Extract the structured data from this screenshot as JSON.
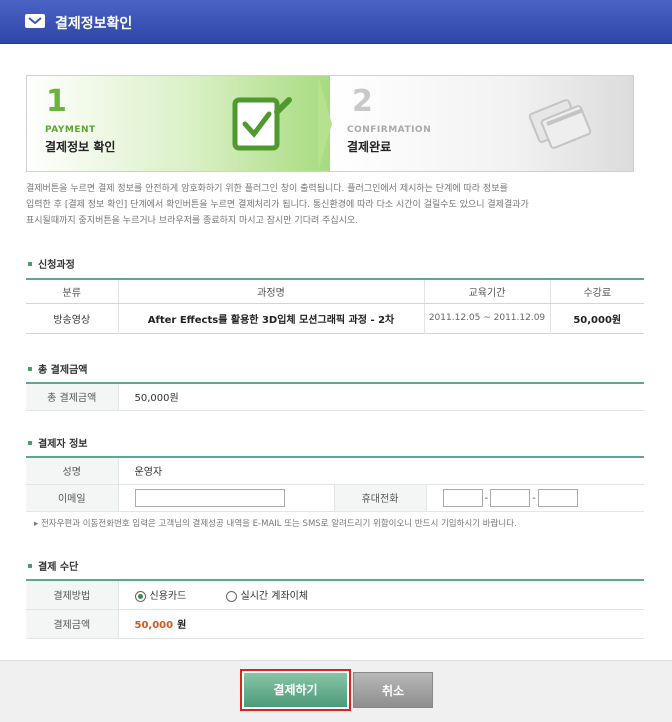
{
  "header": {
    "title": "결제정보확인"
  },
  "steps": [
    {
      "number": "1",
      "en": "PAYMENT",
      "ko": "결제정보 확인"
    },
    {
      "number": "2",
      "en": "CONFIRMATION",
      "ko": "결제완료"
    }
  ],
  "description": [
    "결제버튼을 누르면 결제 정보를 안전하게 암호화하기 위한 플러그인 창이 출력됩니다. 플러그인에서 제시하는 단계에 따라 정보를",
    "입력한 후 [결제 정보 확인] 단계에서 확인버튼을 누르면 결제처리가 됩니다. 통신환경에 따라 다소 시간이 걸릴수도 있으니 결제결과가",
    "표시될때까지 중지버튼을 누르거나 브라우저를 종료하지 마시고 잠시만 기다려 주십시오."
  ],
  "course_section": {
    "title": "신청과정",
    "headers": [
      "분류",
      "과정명",
      "교육기간",
      "수강료"
    ],
    "row": {
      "category": "방송영상",
      "name": "After Effects를 활용한 3D입체 모션그래픽 과정 - 2차",
      "period": "2011.12.05 ~ 2011.12.09",
      "fee": "50,000원"
    }
  },
  "total_section": {
    "title": "총 결제금액",
    "label": "총 결제금액",
    "value": "50,000원"
  },
  "payer_section": {
    "title": "결제자 정보",
    "name_label": "성명",
    "name_value": "운영자",
    "email_label": "이메일",
    "email_value": "",
    "phone_label": "휴대전화",
    "phone_parts": [
      "",
      "",
      ""
    ],
    "note": "전자우편과 이동전화번호 입력은 고객님의 결제성공 내역을 E-MAIL 또는 SMS로 알려드리기 위함이오니 반드시 기입하시기 바랍니다."
  },
  "method_section": {
    "title": "결제 수단",
    "method_label": "결제방법",
    "options": [
      {
        "label": "신용카드",
        "selected": true
      },
      {
        "label": "실시간 계좌이체",
        "selected": false
      }
    ],
    "amount_label": "결제금액",
    "amount_value": "50,000",
    "amount_unit": "원"
  },
  "buttons": {
    "pay": "결제하기",
    "cancel": "취소"
  },
  "colors": {
    "header": "#3a54b8",
    "accent": "#5aa98a",
    "amount": "#d0581c",
    "highlight_border": "#e0221b"
  }
}
